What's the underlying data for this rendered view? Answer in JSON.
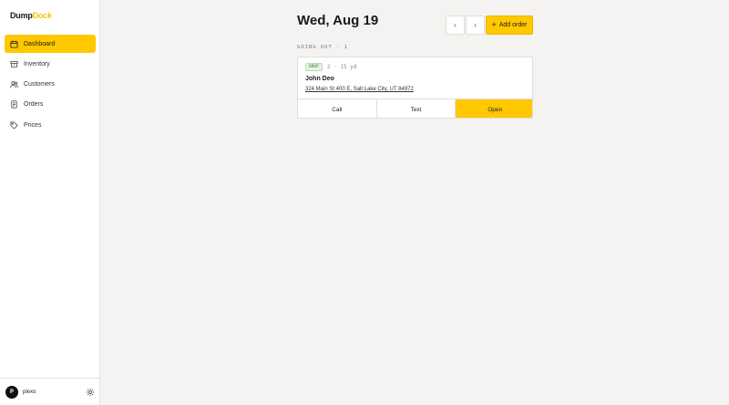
{
  "brand": {
    "part1": "Dump",
    "part2": "Dock"
  },
  "nav": [
    {
      "label": "Dashboard",
      "icon": "calendar-icon",
      "active": true
    },
    {
      "label": "Inventory",
      "icon": "box-icon",
      "active": false
    },
    {
      "label": "Customers",
      "icon": "users-icon",
      "active": false
    },
    {
      "label": "Orders",
      "icon": "document-icon",
      "active": false
    },
    {
      "label": "Prices",
      "icon": "tag-icon",
      "active": false
    }
  ],
  "user": {
    "initial": "P",
    "name": "plexo"
  },
  "header": {
    "date": "Wed, Aug 19",
    "prev": "‹",
    "next": "›",
    "add_order": "Add order"
  },
  "section": {
    "label": "GOING OUT · 1"
  },
  "order": {
    "type": "DROP",
    "quantity": "2 · 15 yd",
    "customer": "John Deo",
    "address": "324 Main St 400 E, Salt Lake City, UT 84972",
    "actions": {
      "call": "Call",
      "text": "Text",
      "open": "Open"
    }
  },
  "colors": {
    "accent": "#ffc800",
    "background": "#f4f3f1",
    "drop_badge": "#e5f3e2"
  }
}
